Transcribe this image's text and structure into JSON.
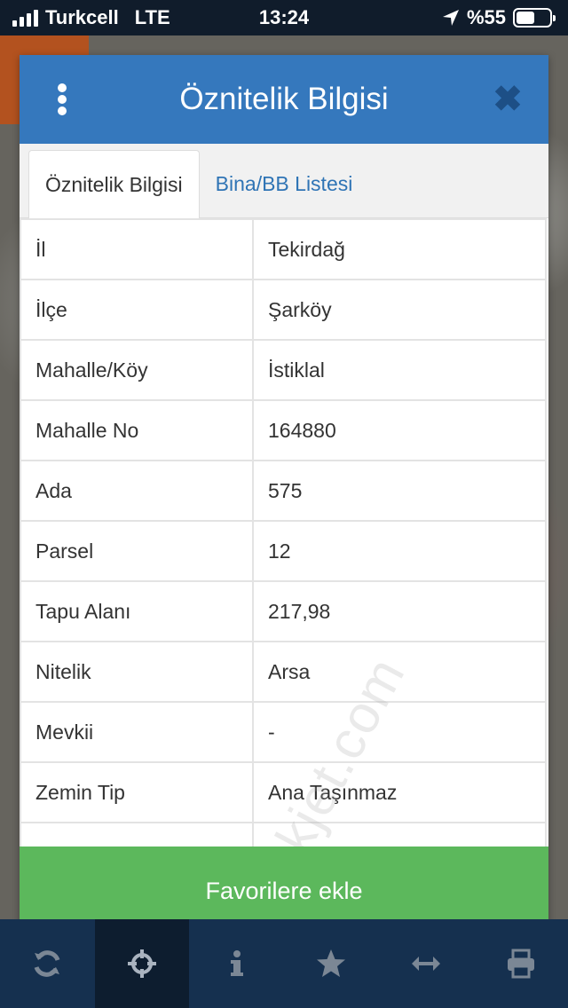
{
  "status_bar": {
    "carrier": "Turkcell",
    "network": "LTE",
    "time": "13:24",
    "battery": "%55",
    "battery_level": 0.55
  },
  "modal": {
    "title": "Öznitelik Bilgisi",
    "tabs": [
      {
        "label": "Öznitelik Bilgisi",
        "active": true
      },
      {
        "label": "Bina/BB Listesi",
        "active": false
      }
    ],
    "rows": [
      {
        "key": "İl",
        "value": "Tekirdağ"
      },
      {
        "key": "İlçe",
        "value": "Şarköy"
      },
      {
        "key": "Mahalle/Köy",
        "value": "İstiklal"
      },
      {
        "key": "Mahalle No",
        "value": "164880"
      },
      {
        "key": "Ada",
        "value": "575"
      },
      {
        "key": "Parsel",
        "value": "12"
      },
      {
        "key": "Tapu Alanı",
        "value": "217,98"
      },
      {
        "key": "Nitelik",
        "value": "Arsa"
      },
      {
        "key": "Mevkii",
        "value": "-"
      },
      {
        "key": "Zemin Tip",
        "value": "Ana Taşınmaz"
      }
    ],
    "favorite_button": "Favorilere ekle",
    "watermark": "emlakjet.com"
  },
  "toolbar": {
    "items": [
      {
        "icon": "refresh-icon"
      },
      {
        "icon": "crosshair-icon",
        "active": true
      },
      {
        "icon": "info-icon"
      },
      {
        "icon": "star-icon"
      },
      {
        "icon": "measure-icon"
      },
      {
        "icon": "print-icon"
      }
    ]
  },
  "colors": {
    "header_blue": "#3578bd",
    "tab_link": "#2f74b5",
    "button_green": "#5cb85c",
    "toolbar": "#15304f"
  }
}
